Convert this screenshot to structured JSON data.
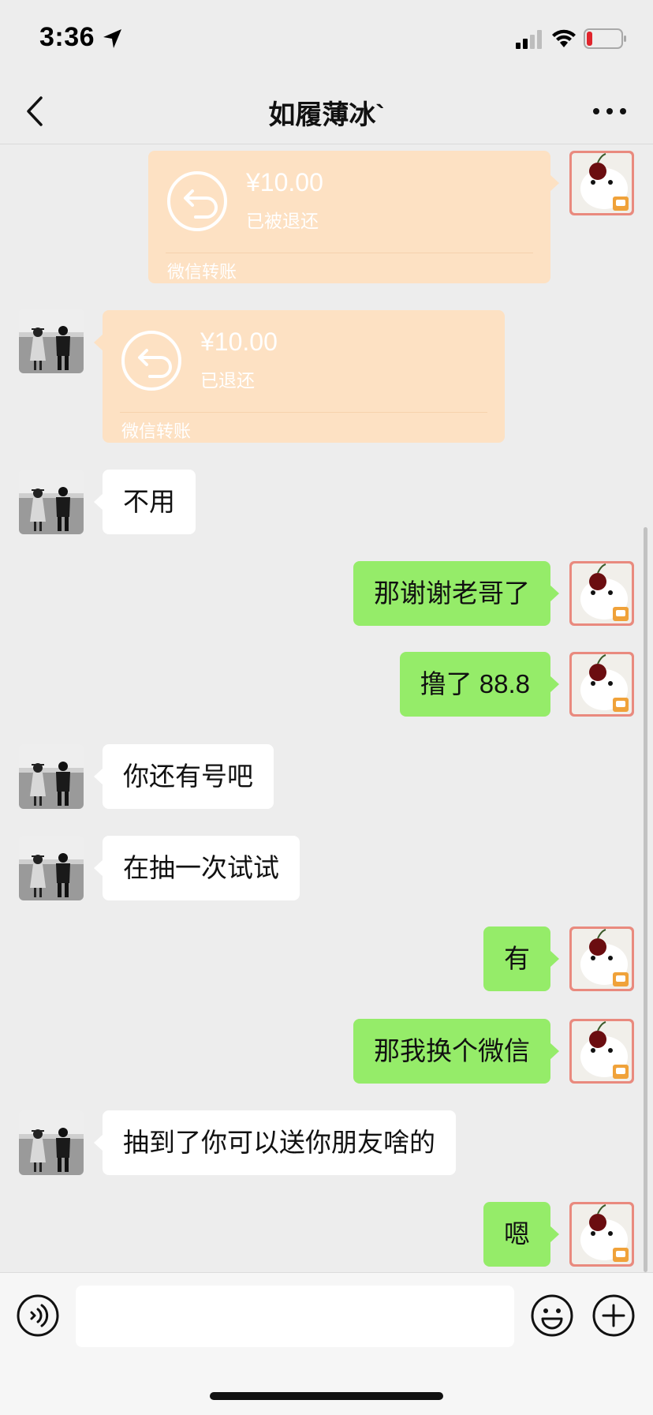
{
  "status_bar": {
    "time": "3:36"
  },
  "header": {
    "title": "如履薄冰`"
  },
  "messages": [
    {
      "type": "transfer",
      "side": "self",
      "amount": "¥10.00",
      "status": "已被退还",
      "label": "微信转账"
    },
    {
      "type": "transfer",
      "side": "friend",
      "amount": "¥10.00",
      "status": "已退还",
      "label": "微信转账"
    },
    {
      "type": "text",
      "side": "friend",
      "text": "不用"
    },
    {
      "type": "text",
      "side": "self",
      "text": "那谢谢老哥了"
    },
    {
      "type": "text",
      "side": "self",
      "text": "撸了 88.8"
    },
    {
      "type": "text",
      "side": "friend",
      "text": "你还有号吧"
    },
    {
      "type": "text",
      "side": "friend",
      "text": "在抽一次试试"
    },
    {
      "type": "text",
      "side": "self",
      "text": "有"
    },
    {
      "type": "text",
      "side": "self",
      "text": "那我换个微信"
    },
    {
      "type": "text",
      "side": "friend",
      "text": "抽到了你可以送你朋友啥的"
    },
    {
      "type": "text",
      "side": "self",
      "text": "嗯"
    }
  ],
  "input_bar": {
    "text_value": "",
    "icons": [
      "voice-icon",
      "emoji-icon",
      "plus-icon"
    ]
  },
  "colors": {
    "outgoing_bubble": "#95ec69",
    "incoming_bubble": "#ffffff",
    "transfer_card": "#fde1c3",
    "background": "#ededed"
  }
}
